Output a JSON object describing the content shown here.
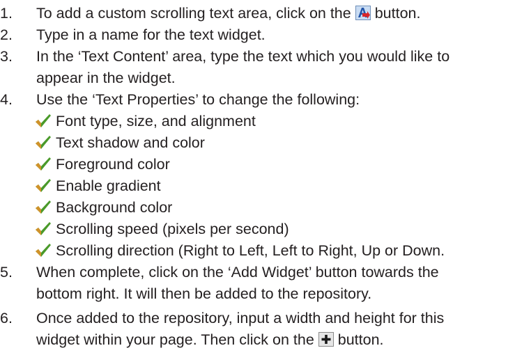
{
  "steps": [
    {
      "number": "1.",
      "text_before": "To add a custom scrolling text area, click on the",
      "icon": "add-text-widget-icon",
      "text_after": "button."
    },
    {
      "number": "2.",
      "text": "Type in a name for the text widget."
    },
    {
      "number": "3.",
      "lines": [
        "In the ‘Text Content’ area, type the text which you would like to",
        "appear in the widget."
      ]
    },
    {
      "number": "4.",
      "text": "Use the ‘Text Properties’ to change the following:",
      "bullets": [
        "Font type, size, and alignment",
        "Text shadow and color",
        "Foreground color",
        "Enable gradient",
        "Background color",
        "Scrolling speed (pixels per second)",
        "Scrolling direction (Right to Left, Left to Right, Up or Down."
      ]
    },
    {
      "number": "5.",
      "lines": [
        "When complete, click on the ‘Add Widget’ button towards the",
        "bottom right.  It will then be added to the repository."
      ]
    },
    {
      "number": "6.",
      "lines": [
        "Once added to the repository, input a width and height for this"
      ],
      "line2_before": "widget within your page.  Then click on the",
      "icon": "plus-icon",
      "line2_after": "button."
    }
  ],
  "colors": {
    "text": "#231f20",
    "check_green": "#4a9a2a",
    "check_orange": "#e8902a"
  }
}
